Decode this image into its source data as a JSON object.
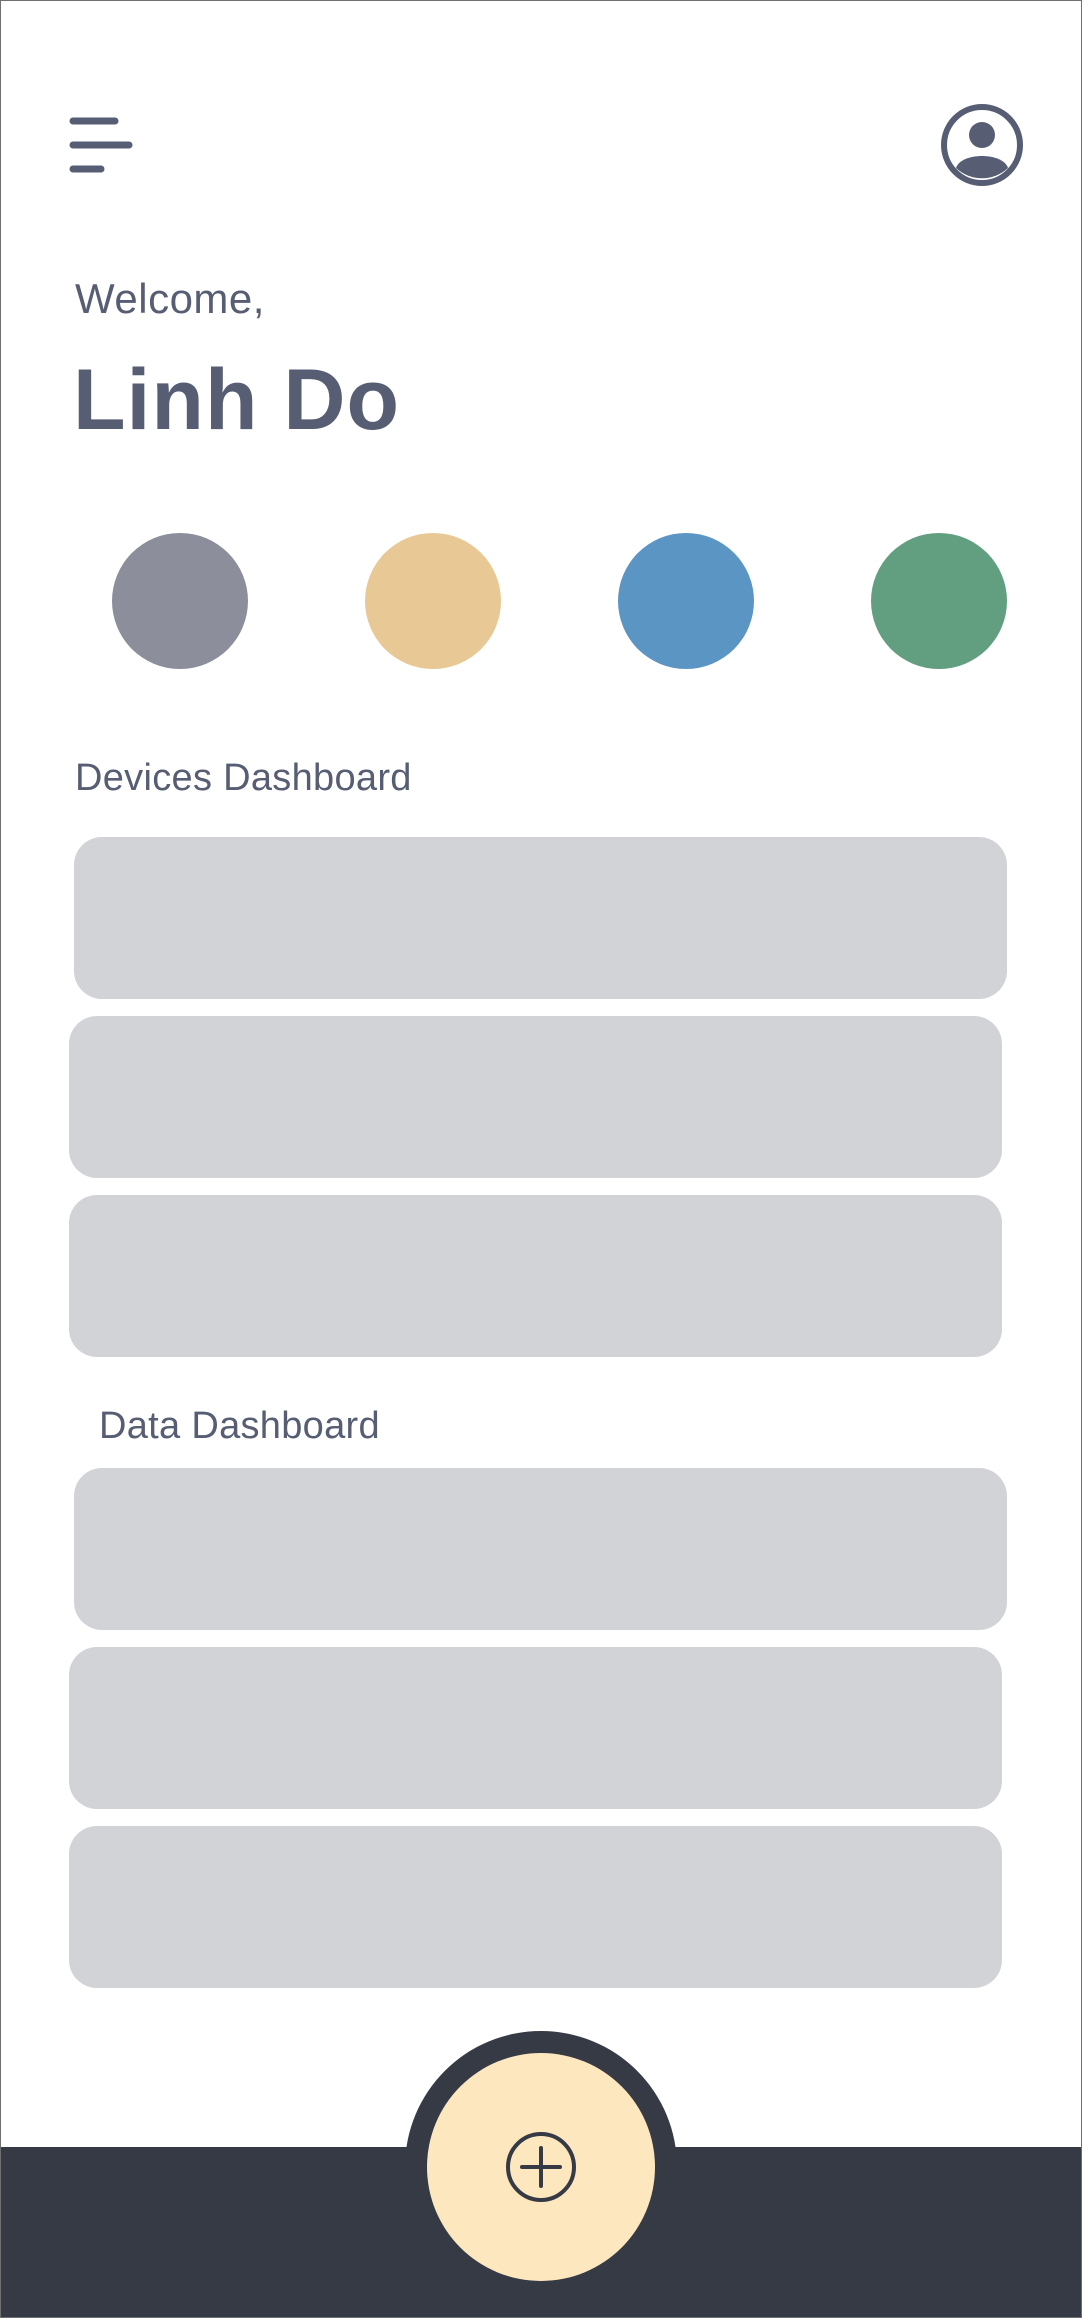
{
  "header": {
    "menu_icon": "hamburger-menu-icon",
    "profile_icon": "user-account-icon"
  },
  "greeting": {
    "welcome": "Welcome,",
    "name": "Linh Do"
  },
  "quick_circles": [
    {
      "color": "#8c8f9b"
    },
    {
      "color": "#e8c995"
    },
    {
      "color": "#5b95c3"
    },
    {
      "color": "#629f80"
    }
  ],
  "devices_section": {
    "title": "Devices Dashboard",
    "card_count": 3
  },
  "data_section": {
    "title": "Data Dashboard",
    "card_count": 3
  },
  "bottom_bar": {
    "add_icon": "plus-circle-icon"
  },
  "colors": {
    "text": "#575e74",
    "card": "#d2d3d7",
    "bar": "#363a45",
    "fab": "#fde7bf"
  }
}
